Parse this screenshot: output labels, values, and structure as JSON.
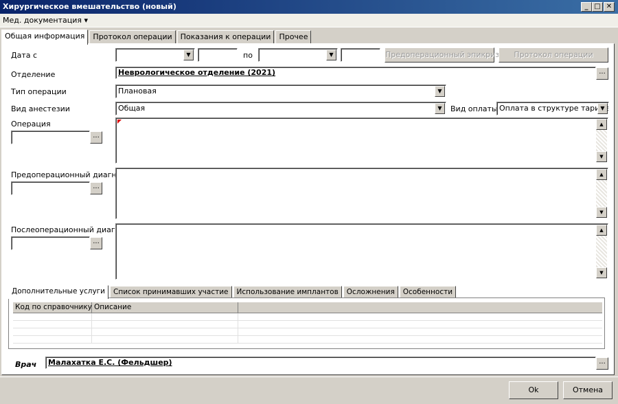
{
  "window": {
    "title": "Хирургическое вмешательство (новый)",
    "min_glyph": "_",
    "max_glyph": "□",
    "close_glyph": "✕"
  },
  "menu": {
    "med_docs": "Мед. документация ▾"
  },
  "tabs": [
    {
      "label": "Общая информация"
    },
    {
      "label": "Протокол операции"
    },
    {
      "label": "Показания к операции"
    },
    {
      "label": "Прочее"
    }
  ],
  "form": {
    "date_from_label": "Дата с",
    "date_from_value": "",
    "time_from_value": "",
    "to_label": "по",
    "date_to_value": "",
    "time_to_value": "",
    "preop_epicrisis_button": "Предоперационный эпикриз",
    "op_protocol_button": "Протокол операции",
    "department_label": "Отделение",
    "department_value": "Неврологическое отделение (2021)",
    "op_type_label": "Тип операции",
    "op_type_value": "Плановая",
    "anesthesia_label": "Вид анестезии",
    "anesthesia_value": "Общая",
    "payment_label": "Вид оплаты",
    "payment_value": "Оплата в структуре тарифа",
    "operation_label": "Операция",
    "operation_code": "",
    "preop_diag_label": "Предоперационный диагноз",
    "preop_diag_code": "",
    "postop_diag_label": "Послеоперационный диагноз",
    "postop_diag_code": "",
    "dots": "...",
    "dropdown_glyph": "▼",
    "scroll_up_glyph": "▲",
    "scroll_down_glyph": "▼"
  },
  "subtabs": [
    {
      "label": "Дополнительные услуги"
    },
    {
      "label": "Список принимавших участие"
    },
    {
      "label": "Использование имплантов"
    },
    {
      "label": "Осложнения"
    },
    {
      "label": "Особенности"
    }
  ],
  "grid": {
    "columns": [
      "Код по справочнику",
      "Описание",
      ""
    ]
  },
  "doctor": {
    "label": "Врач",
    "value": "Малахатка Е.С. (Фельдшер)"
  },
  "footer": {
    "ok": "Ok",
    "cancel": "Отмена"
  }
}
